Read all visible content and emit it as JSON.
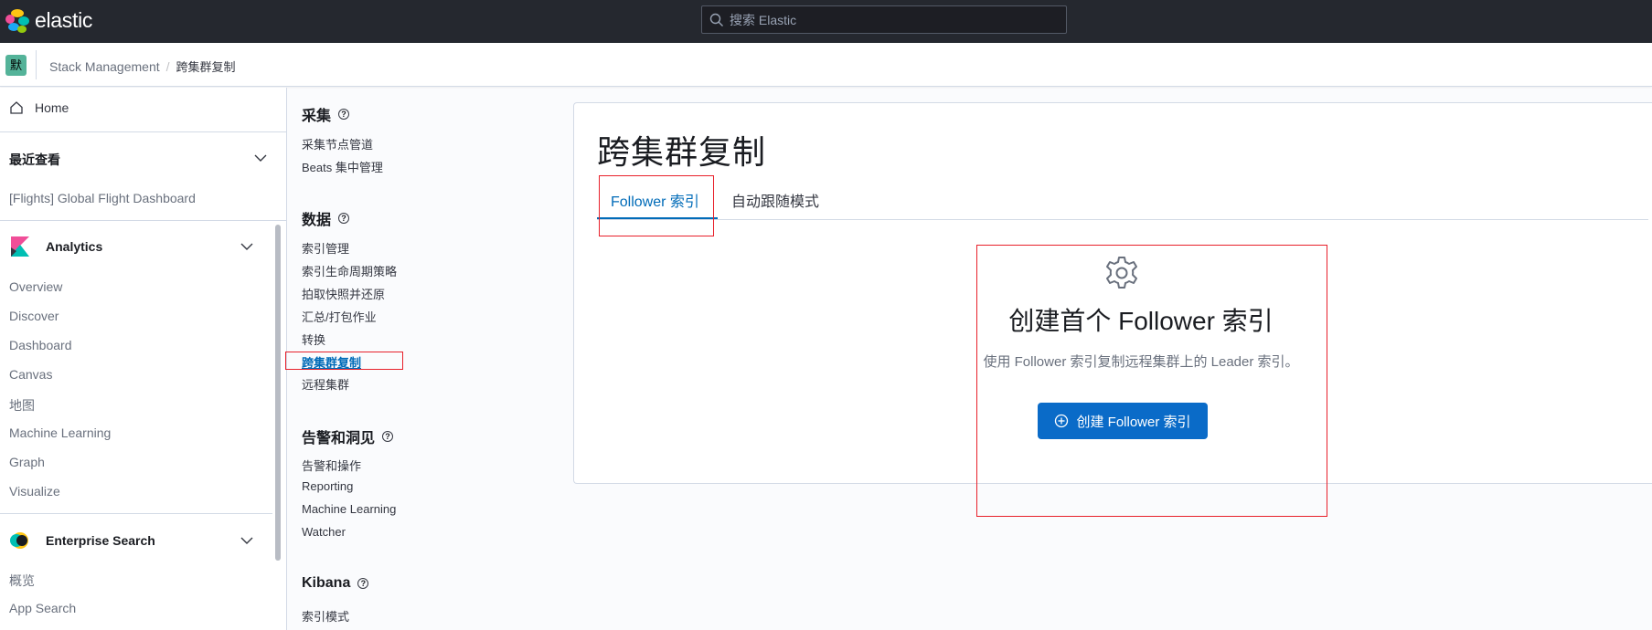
{
  "header": {
    "logo_text": "elastic",
    "search_placeholder": "搜索 Elastic"
  },
  "breadcrumb": {
    "space_avatar": "默",
    "items": [
      "Stack Management",
      "跨集群复制"
    ]
  },
  "left_nav": {
    "home": "Home",
    "recent_title": "最近查看",
    "recent_items": [
      "[Flights] Global Flight Dashboard"
    ],
    "analytics": {
      "title": "Analytics",
      "items": [
        "Overview",
        "Discover",
        "Dashboard",
        "Canvas",
        "地图",
        "Machine Learning",
        "Graph",
        "Visualize"
      ]
    },
    "enterprise_search": {
      "title": "Enterprise Search",
      "items": [
        "概览",
        "App Search"
      ]
    }
  },
  "management_nav": {
    "sections": [
      {
        "title": "采集",
        "items": [
          "采集节点管道",
          "Beats 集中管理"
        ]
      },
      {
        "title": "数据",
        "items": [
          "索引管理",
          "索引生命周期策略",
          "拍取快照并还原",
          "汇总/打包作业",
          "转换",
          "跨集群复制",
          "远程集群"
        ]
      },
      {
        "title": "告警和洞见",
        "items": [
          "告警和操作",
          "Reporting",
          "Machine Learning",
          "Watcher"
        ]
      },
      {
        "title": "Kibana",
        "items": [
          "索引模式"
        ]
      }
    ],
    "active_item": "跨集群复制"
  },
  "main": {
    "title": "跨集群复制",
    "tabs": [
      "Follower 索引",
      "自动跟随模式"
    ],
    "selected_tab": "Follower 索引",
    "empty_state": {
      "icon": "gear-icon",
      "title": "创建首个 Follower 索引",
      "body": "使用 Follower 索引复制远程集群上的 Leader 索引。",
      "button": "创建 Follower 索引"
    }
  },
  "colors": {
    "header_bg": "#25282f",
    "accent": "#006bb8",
    "primary_button": "#0a6bc8",
    "annotation_red": "#e8202a",
    "space_avatar_bg": "#54b399"
  }
}
